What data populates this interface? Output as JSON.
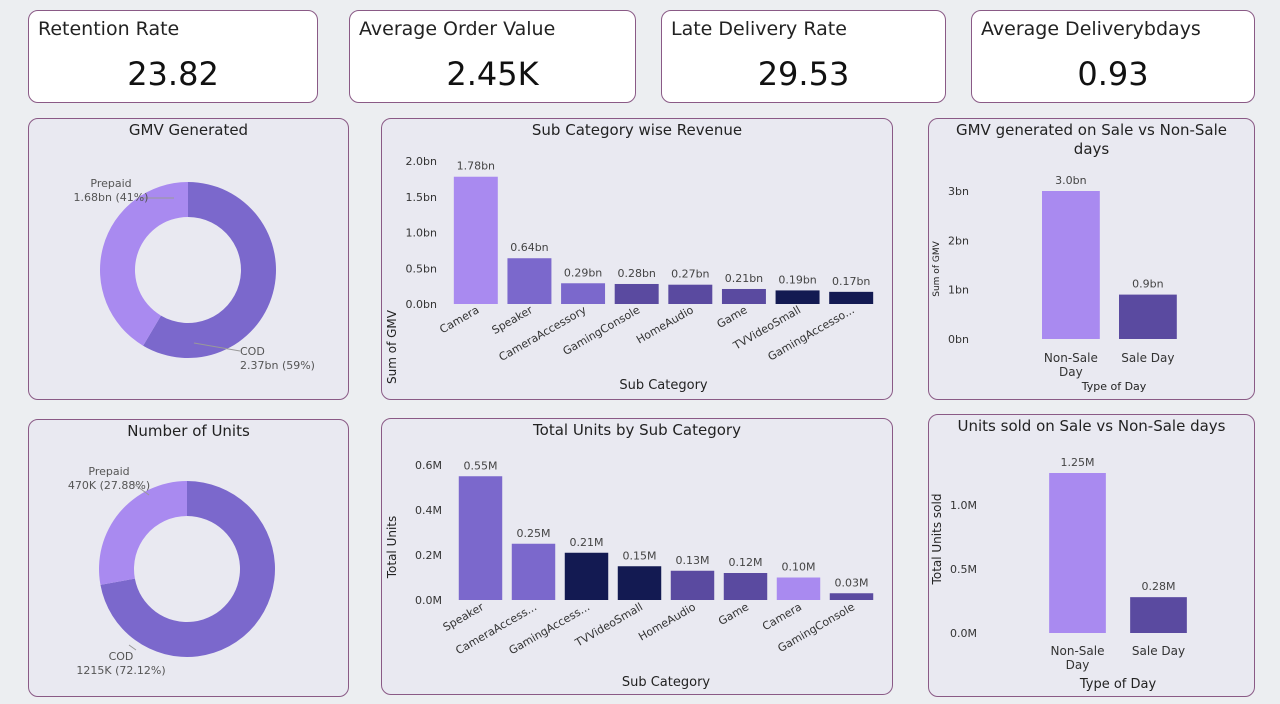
{
  "kpis": [
    {
      "label": "Retention Rate",
      "value": "23.82"
    },
    {
      "label": "Average Order Value",
      "value": "2.45K"
    },
    {
      "label": "Late Delivery Rate",
      "value": "29.53"
    },
    {
      "label": "Average Deliverybdays",
      "value": "0.93"
    }
  ],
  "titles": {
    "gmv_donut": "GMV Generated",
    "gmv_sub": "Sub Category wise Revenue",
    "gmv_sale_l1": "GMV generated on Sale vs Non-Sale",
    "gmv_sale_l2": "days",
    "units_donut": "Number of Units",
    "units_sub": "Total Units by Sub Category",
    "units_sale": "Units sold on Sale vs Non-Sale days"
  },
  "chart_data": [
    {
      "id": "gmv_donut",
      "type": "pie",
      "slices": [
        {
          "name": "COD",
          "value": 2.37,
          "label": "2.37bn (59%)",
          "color": "#7b68cc"
        },
        {
          "name": "Prepaid",
          "value": 1.68,
          "label": "1.68bn (41%)",
          "color": "#a98af0"
        }
      ]
    },
    {
      "id": "gmv_sub",
      "type": "bar",
      "xlabel": "Sub Category",
      "ylabel": "Sum of GMV",
      "categories": [
        "Camera",
        "Speaker",
        "CameraAccessory",
        "GamingConsole",
        "HomeAudio",
        "Game",
        "TVVideoSmall",
        "GamingAccesso..."
      ],
      "values": [
        1.78,
        0.64,
        0.29,
        0.28,
        0.27,
        0.21,
        0.19,
        0.17
      ],
      "value_labels": [
        "1.78bn",
        "0.64bn",
        "0.29bn",
        "0.28bn",
        "0.27bn",
        "0.21bn",
        "0.19bn",
        "0.17bn"
      ],
      "colors": [
        "#a98af0",
        "#7b68cc",
        "#7b68cc",
        "#5a4aa0",
        "#5a4aa0",
        "#5a4aa0",
        "#131a52",
        "#131a52"
      ],
      "ylim": [
        0,
        2.0
      ],
      "yticks": [
        0,
        0.5,
        1.0,
        1.5,
        2.0
      ],
      "ytick_labels": [
        "0.0bn",
        "0.5bn",
        "1.0bn",
        "1.5bn",
        "2.0bn"
      ]
    },
    {
      "id": "gmv_sale",
      "type": "bar",
      "xlabel": "Type of Day",
      "ylabel": "Sum of GMV",
      "categories": [
        [
          "Non-Sale",
          "Day"
        ],
        [
          "Sale Day"
        ]
      ],
      "values": [
        3.0,
        0.9
      ],
      "value_labels": [
        "3.0bn",
        "0.9bn"
      ],
      "colors": [
        "#a98af0",
        "#5a4aa0"
      ],
      "ylim": [
        0,
        3.0
      ],
      "yticks": [
        0,
        1,
        2,
        3
      ],
      "ytick_labels": [
        "0bn",
        "1bn",
        "2bn",
        "3bn"
      ]
    },
    {
      "id": "units_donut",
      "type": "pie",
      "slices": [
        {
          "name": "COD",
          "value": 1215,
          "label": "1215K (72.12%)",
          "color": "#7b68cc"
        },
        {
          "name": "Prepaid",
          "value": 470,
          "label": "470K (27.88%)",
          "color": "#a98af0"
        }
      ]
    },
    {
      "id": "units_sub",
      "type": "bar",
      "xlabel": "Sub Category",
      "ylabel": "Total Units",
      "categories": [
        "Speaker",
        "CameraAccess...",
        "GamingAccess...",
        "TVVideoSmall",
        "HomeAudio",
        "Game",
        "Camera",
        "GamingConsole"
      ],
      "values": [
        0.55,
        0.25,
        0.21,
        0.15,
        0.13,
        0.12,
        0.1,
        0.03
      ],
      "value_labels": [
        "0.55M",
        "0.25M",
        "0.21M",
        "0.15M",
        "0.13M",
        "0.12M",
        "0.10M",
        "0.03M"
      ],
      "colors": [
        "#7b68cc",
        "#7b68cc",
        "#131a52",
        "#131a52",
        "#5a4aa0",
        "#5a4aa0",
        "#a98af0",
        "#5a4aa0"
      ],
      "ylim": [
        0,
        0.6
      ],
      "yticks": [
        0,
        0.2,
        0.4,
        0.6
      ],
      "ytick_labels": [
        "0.0M",
        "0.2M",
        "0.4M",
        "0.6M"
      ]
    },
    {
      "id": "units_sale",
      "type": "bar",
      "xlabel": "Type of Day",
      "ylabel": "Total Units sold",
      "categories": [
        [
          "Non-Sale",
          "Day"
        ],
        [
          "Sale Day"
        ]
      ],
      "values": [
        1.25,
        0.28
      ],
      "value_labels": [
        "1.25M",
        "0.28M"
      ],
      "colors": [
        "#a98af0",
        "#5a4aa0"
      ],
      "ylim": [
        0,
        1.25
      ],
      "yticks": [
        0,
        0.5,
        1.0
      ],
      "ytick_labels": [
        "0.0M",
        "0.5M",
        "1.0M"
      ]
    }
  ]
}
